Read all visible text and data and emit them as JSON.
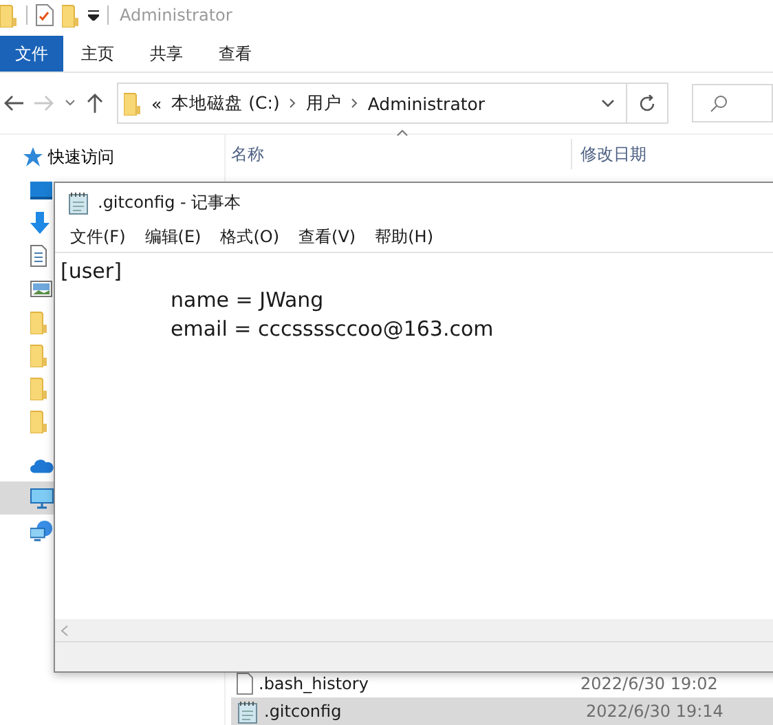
{
  "explorer": {
    "title": "Administrator",
    "ribbon_tabs": [
      {
        "label": "文件",
        "selected": true
      },
      {
        "label": "主页",
        "selected": false
      },
      {
        "label": "共享",
        "selected": false
      },
      {
        "label": "查看",
        "selected": false
      }
    ],
    "nav": {
      "forward_disabled": true
    },
    "address": {
      "overflow": "«",
      "crumbs": [
        "本地磁盘 (C:)",
        "用户",
        "Administrator"
      ]
    },
    "sidebar": {
      "quick_access": "快速访问",
      "items": [
        {
          "kind": "desktop",
          "selected": false
        },
        {
          "kind": "download",
          "selected": false
        },
        {
          "kind": "document",
          "selected": false
        },
        {
          "kind": "image",
          "selected": false
        },
        {
          "kind": "folder",
          "selected": false
        },
        {
          "kind": "folder",
          "selected": false
        },
        {
          "kind": "folder",
          "selected": false
        },
        {
          "kind": "folder",
          "selected": false
        },
        {
          "kind": "cloud",
          "selected": false
        },
        {
          "kind": "pc",
          "selected": true
        },
        {
          "kind": "network",
          "selected": false
        }
      ]
    },
    "columns": [
      "名称",
      "修改日期"
    ],
    "files": [
      {
        "name": ".bash_history",
        "date": "2022/6/30 19:02",
        "kind": "blank",
        "selected": false
      },
      {
        "name": ".gitconfig",
        "date": "2022/6/30 19:14",
        "kind": "notepad",
        "selected": true
      }
    ]
  },
  "notepad": {
    "title": ".gitconfig - 记事本",
    "menu": [
      "文件(F)",
      "编辑(E)",
      "格式(O)",
      "查看(V)",
      "帮助(H)"
    ],
    "lines": [
      {
        "text": "[user]",
        "indented": false
      },
      {
        "text": "name = JWang",
        "indented": true
      },
      {
        "text": "email = cccssssccoo@163.com",
        "indented": true
      }
    ]
  }
}
